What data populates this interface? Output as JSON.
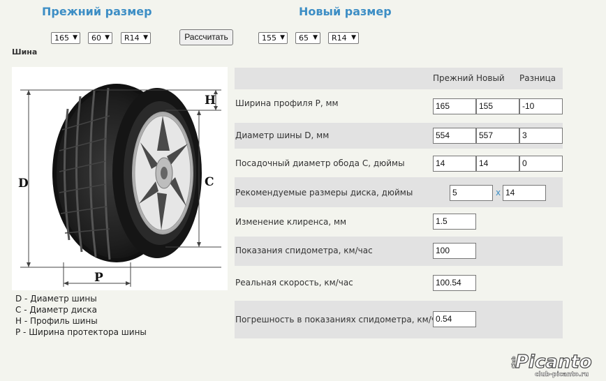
{
  "header": {
    "old_size_title": "Прежний размер",
    "new_size_title": "Новый размер"
  },
  "old_size": {
    "width": "165",
    "profile": "60",
    "rim": "R14"
  },
  "new_size": {
    "width": "155",
    "profile": "65",
    "rim": "R14"
  },
  "calculate_label": "Рассчитать",
  "section_title": "Шина",
  "diagram": {
    "labels": {
      "d": "D",
      "c": "C",
      "h": "H",
      "p": "P"
    }
  },
  "legend": [
    "D - Диаметр шины",
    "C - Диаметр диска",
    "H - Профиль шины",
    "P - Ширина протектора шины"
  ],
  "table": {
    "headers": {
      "old": "Прежний",
      "new": "Новый",
      "diff": "Разница"
    },
    "rows": [
      {
        "label": "Ширина профиля P, мм",
        "old": "165",
        "new": "155",
        "diff": "-10"
      },
      {
        "label": "Диаметр шины D, мм",
        "old": "554",
        "new": "557",
        "diff": "3"
      },
      {
        "label": "Посадочный диаметр обода C, дюймы",
        "old": "14",
        "new": "14",
        "diff": "0"
      }
    ],
    "rim_recommend": {
      "label": "Рекомендуемые размеры диска, дюймы",
      "width": "5",
      "sep": "x",
      "diameter": "14"
    },
    "clearance": {
      "label": "Изменение клиренса, мм",
      "value": "1.5"
    },
    "speedometer": {
      "label": "Показания спидометра, км/час",
      "value": "100"
    },
    "real_speed": {
      "label": "Реальная скорость, км/час",
      "value": "100.54"
    },
    "error": {
      "label": "Погрешность в показаниях спидометра, км/час",
      "value": "0.54"
    }
  },
  "logo": {
    "text": "Picanto",
    "club": "Club",
    "url": "club-picanto.ru"
  },
  "colors": {
    "accent": "#3d8ec5",
    "background": "#f3f4ee",
    "row_shade": "#e2e2e2"
  }
}
